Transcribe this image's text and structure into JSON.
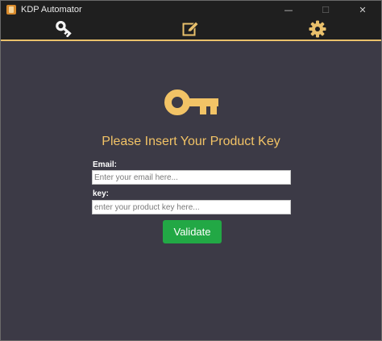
{
  "window": {
    "title": "KDP Automator",
    "minimize_glyph": "—",
    "maximize_glyph": "☐",
    "close_glyph": "✕"
  },
  "tabs": [
    {
      "name": "key",
      "icon": "key-icon"
    },
    {
      "name": "edit",
      "icon": "edit-icon"
    },
    {
      "name": "settings",
      "icon": "gear-icon"
    }
  ],
  "accent_color": "#e9c06b",
  "main": {
    "icon": "key-icon",
    "heading": "Please Insert Your Product Key",
    "email": {
      "label": "Email:",
      "value": "",
      "placeholder": "Enter your email here..."
    },
    "key": {
      "label": "key:",
      "value": "",
      "placeholder": "enter your product key here..."
    },
    "validate_label": "Validate"
  }
}
